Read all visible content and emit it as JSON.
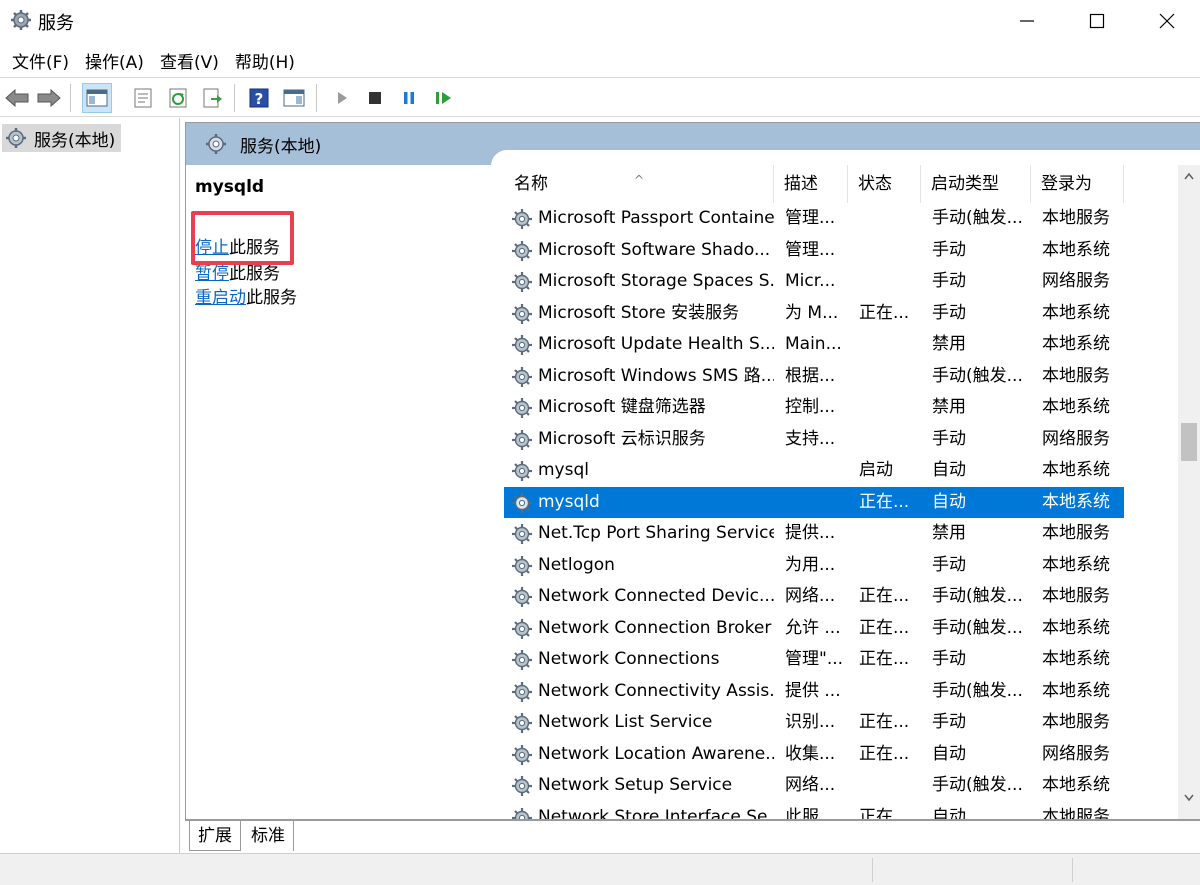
{
  "window": {
    "title": "服务"
  },
  "menu": [
    "文件(F)",
    "操作(A)",
    "查看(V)",
    "帮助(H)"
  ],
  "tree": {
    "root_label": "服务(本地)"
  },
  "pane": {
    "header": "服务(本地)",
    "service_name": "mysqld",
    "actions": [
      {
        "link": "停止",
        "rest": "此服务"
      },
      {
        "link": "暂停",
        "rest": "此服务"
      },
      {
        "link": "重启动",
        "rest": "此服务"
      }
    ]
  },
  "table": {
    "headers": [
      "名称",
      "描述",
      "状态",
      "启动类型",
      "登录为"
    ],
    "rows": [
      {
        "name": "Microsoft Passport Container",
        "desc": "管理...",
        "status": "",
        "type": "手动(触发...",
        "logon": "本地服务"
      },
      {
        "name": "Microsoft Software Shado...",
        "desc": "管理...",
        "status": "",
        "type": "手动",
        "logon": "本地系统"
      },
      {
        "name": "Microsoft Storage Spaces S...",
        "desc": "Micr...",
        "status": "",
        "type": "手动",
        "logon": "网络服务"
      },
      {
        "name": "Microsoft Store 安装服务",
        "desc": "为 M...",
        "status": "正在...",
        "type": "手动",
        "logon": "本地系统"
      },
      {
        "name": "Microsoft Update Health S...",
        "desc": "Main...",
        "status": "",
        "type": "禁用",
        "logon": "本地系统"
      },
      {
        "name": "Microsoft Windows SMS 路...",
        "desc": "根据...",
        "status": "",
        "type": "手动(触发...",
        "logon": "本地服务"
      },
      {
        "name": "Microsoft 键盘筛选器",
        "desc": "控制...",
        "status": "",
        "type": "禁用",
        "logon": "本地系统"
      },
      {
        "name": "Microsoft 云标识服务",
        "desc": "支持...",
        "status": "",
        "type": "手动",
        "logon": "网络服务"
      },
      {
        "name": "mysql",
        "desc": "",
        "status": "启动",
        "type": "自动",
        "logon": "本地系统"
      },
      {
        "name": "mysqld",
        "desc": "",
        "status": "正在...",
        "type": "自动",
        "logon": "本地系统",
        "selected": true
      },
      {
        "name": "Net.Tcp Port Sharing Service",
        "desc": "提供...",
        "status": "",
        "type": "禁用",
        "logon": "本地服务"
      },
      {
        "name": "Netlogon",
        "desc": "为用...",
        "status": "",
        "type": "手动",
        "logon": "本地系统"
      },
      {
        "name": "Network Connected Devic...",
        "desc": "网络...",
        "status": "正在...",
        "type": "手动(触发...",
        "logon": "本地服务"
      },
      {
        "name": "Network Connection Broker",
        "desc": "允许 ...",
        "status": "正在...",
        "type": "手动(触发...",
        "logon": "本地系统"
      },
      {
        "name": "Network Connections",
        "desc": "管理\"...",
        "status": "正在...",
        "type": "手动",
        "logon": "本地系统"
      },
      {
        "name": "Network Connectivity Assis...",
        "desc": "提供 ...",
        "status": "",
        "type": "手动(触发...",
        "logon": "本地系统"
      },
      {
        "name": "Network List Service",
        "desc": "识别...",
        "status": "正在...",
        "type": "手动",
        "logon": "本地服务"
      },
      {
        "name": "Network Location Awarene...",
        "desc": "收集...",
        "status": "正在...",
        "type": "自动",
        "logon": "网络服务"
      },
      {
        "name": "Network Setup Service",
        "desc": "网络...",
        "status": "",
        "type": "手动(触发...",
        "logon": "本地系统"
      },
      {
        "name": "Network Store Interface Se...",
        "desc": "此服...",
        "status": "正在...",
        "type": "自动",
        "logon": "本地服务"
      }
    ]
  },
  "tabs": [
    "扩展",
    "标准"
  ],
  "colors": {
    "accent": "#0078d7",
    "header_band": "#a5bfd9",
    "link": "#0b67c2",
    "highlight_box": "#e8404f"
  }
}
